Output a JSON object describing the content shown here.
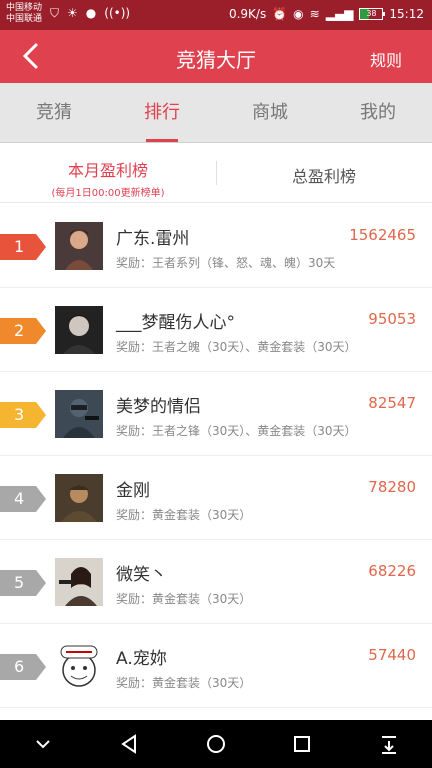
{
  "status": {
    "carrier1": "中国移动",
    "carrier2": "中国联通",
    "speed": "0.9K/s",
    "battery": "38",
    "time": "15:12"
  },
  "header": {
    "title": "竞猜大厅",
    "rules": "规则"
  },
  "tabs": [
    {
      "label": "竞猜"
    },
    {
      "label": "排行"
    },
    {
      "label": "商城"
    },
    {
      "label": "我的"
    }
  ],
  "subtabs": {
    "monthly": "本月盈利榜",
    "monthly_note": "(每月1日00:00更新榜单)",
    "total": "总盈利榜"
  },
  "rows": [
    {
      "rank": "1",
      "name": "广东.雷州",
      "score": "1562465",
      "reward": "奖励：王者系列（锋、怒、魂、魄）30天",
      "color": "#e8533b"
    },
    {
      "rank": "2",
      "name": "___梦醒伤人心°",
      "score": "95053",
      "reward": "奖励：王者之魄（30天）、黄金套装（30天）",
      "color": "#f0892b"
    },
    {
      "rank": "3",
      "name": "美梦的情侣",
      "score": "82547",
      "reward": "奖励：王者之锋（30天）、黄金套装（30天）",
      "color": "#f5b530"
    },
    {
      "rank": "4",
      "name": "金刚",
      "score": "78280",
      "reward": "奖励：黄金套装（30天）",
      "color": "#a8a8a8"
    },
    {
      "rank": "5",
      "name": "微笑丶",
      "score": "68226",
      "reward": "奖励：黄金套装（30天）",
      "color": "#a8a8a8"
    },
    {
      "rank": "6",
      "name": "A.宠妳",
      "score": "57440",
      "reward": "奖励：黄金套装（30天）",
      "color": "#a8a8a8"
    }
  ]
}
